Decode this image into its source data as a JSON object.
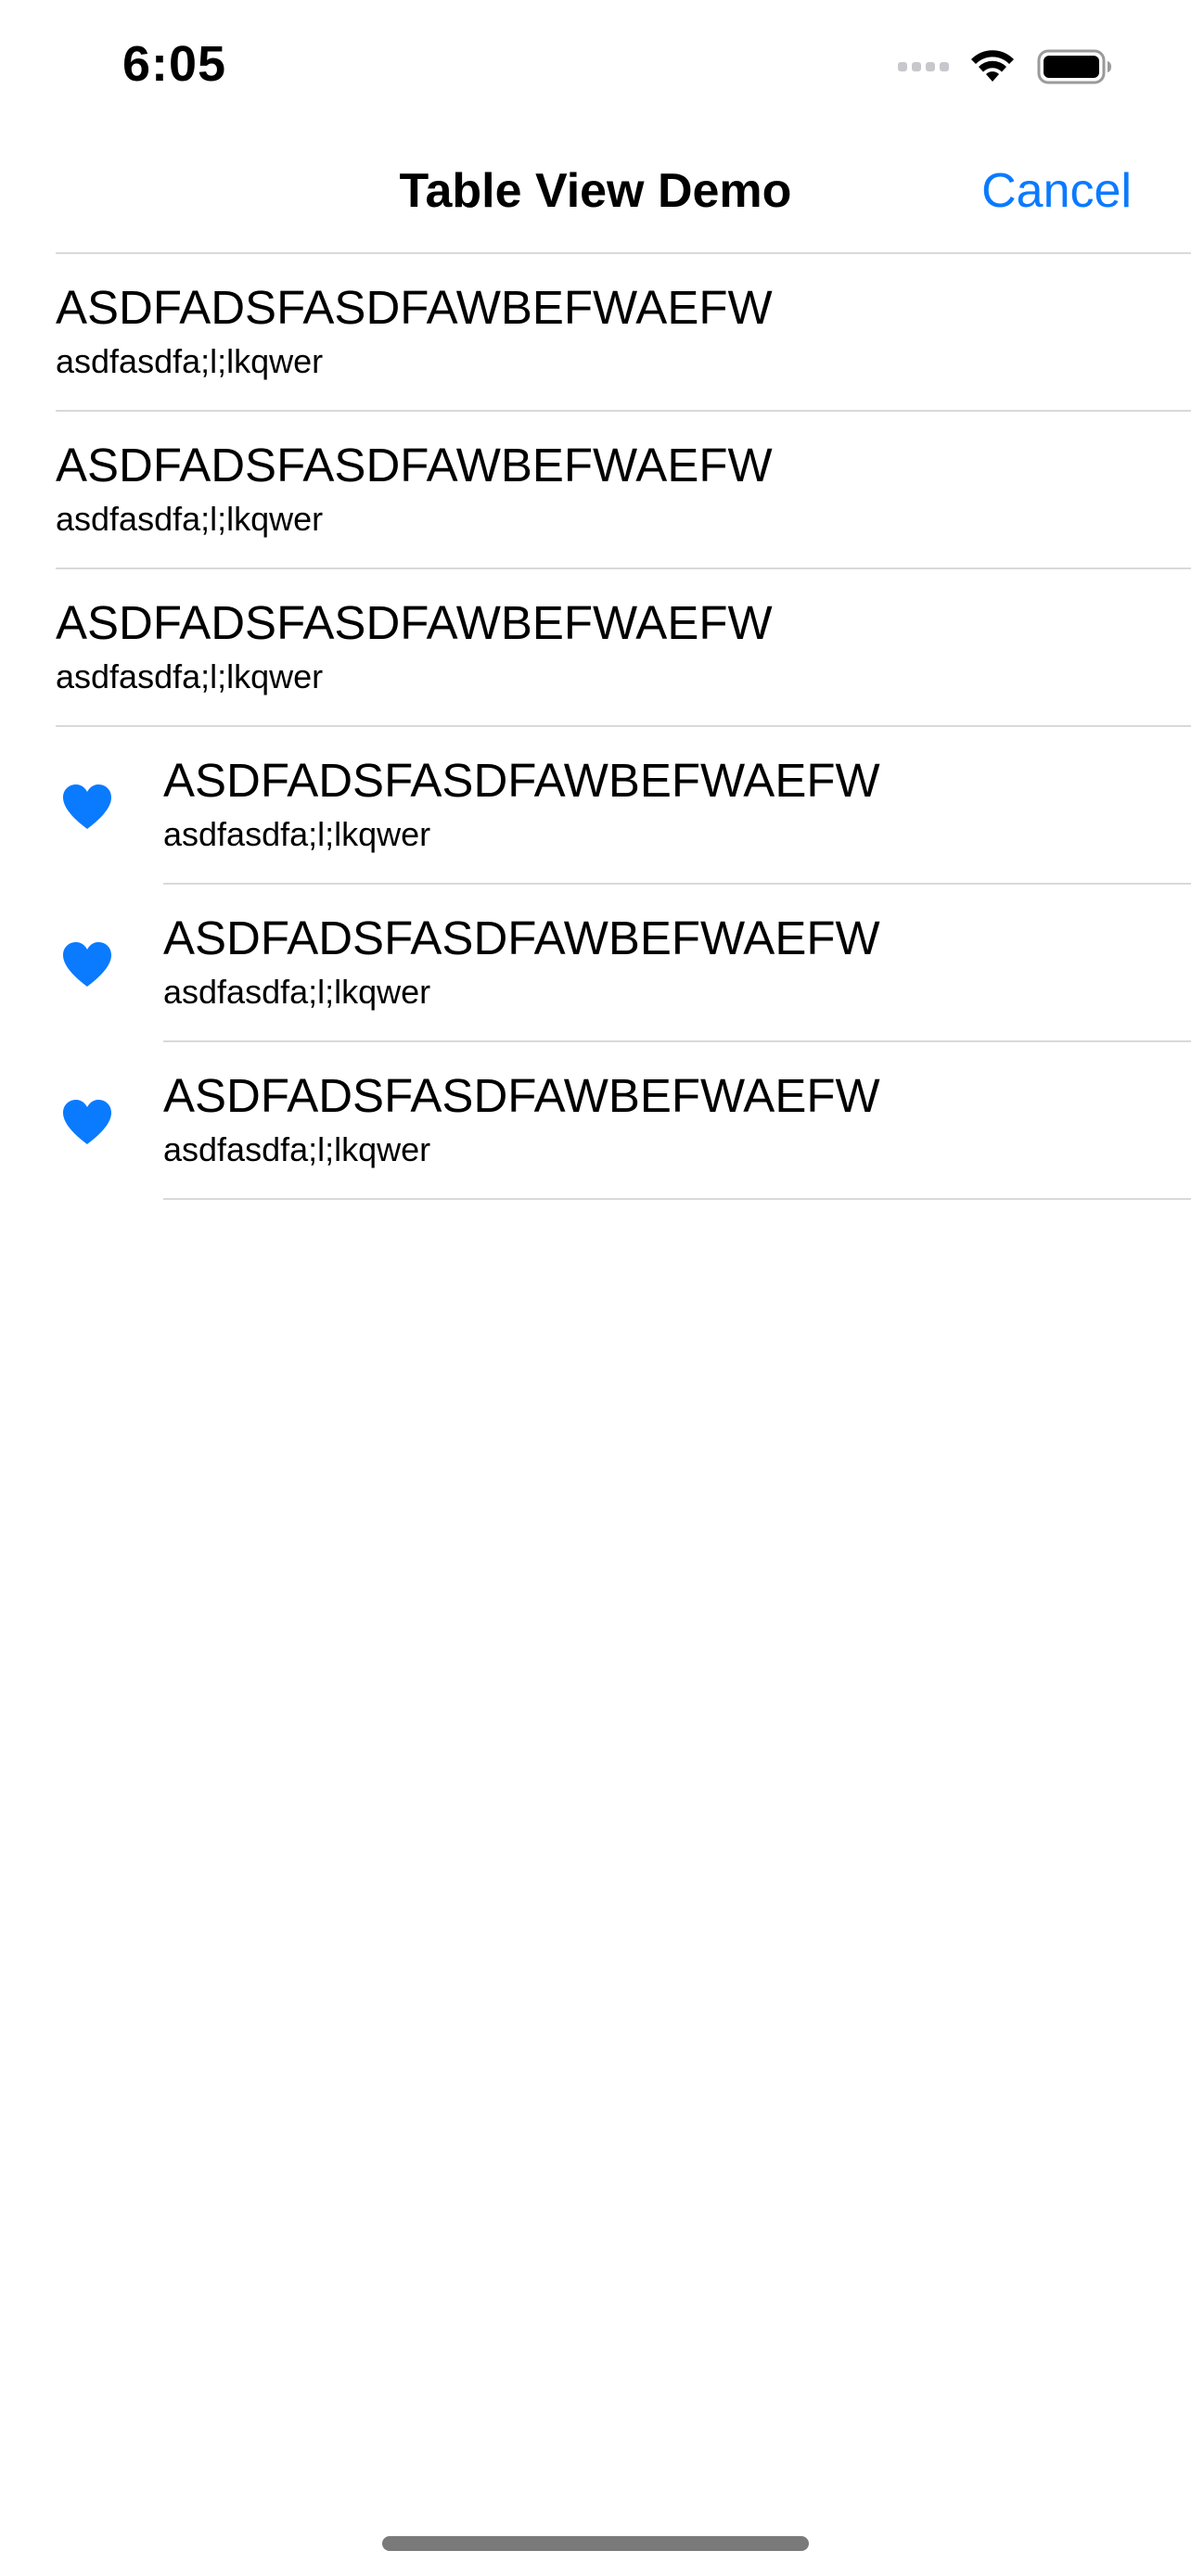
{
  "status_bar": {
    "time": "6:05",
    "icons": [
      "cellular-signal-icon",
      "wifi-icon",
      "battery-icon"
    ]
  },
  "nav": {
    "title": "Table View Demo",
    "cancel_label": "Cancel"
  },
  "colors": {
    "accent": "#0a7aff",
    "separator": "#d9d9dc"
  },
  "rows": [
    {
      "title": "ASDFADSFASDFAWBEFWAEFW",
      "subtitle": "asdfasdfa;l;lkqwer",
      "icon": null
    },
    {
      "title": "ASDFADSFASDFAWBEFWAEFW",
      "subtitle": "asdfasdfa;l;lkqwer",
      "icon": null
    },
    {
      "title": "ASDFADSFASDFAWBEFWAEFW",
      "subtitle": "asdfasdfa;l;lkqwer",
      "icon": null
    },
    {
      "title": "ASDFADSFASDFAWBEFWAEFW",
      "subtitle": "asdfasdfa;l;lkqwer",
      "icon": "heart-icon"
    },
    {
      "title": "ASDFADSFASDFAWBEFWAEFW",
      "subtitle": "asdfasdfa;l;lkqwer",
      "icon": "heart-icon"
    },
    {
      "title": "ASDFADSFASDFAWBEFWAEFW",
      "subtitle": "asdfasdfa;l;lkqwer",
      "icon": "heart-icon"
    }
  ]
}
